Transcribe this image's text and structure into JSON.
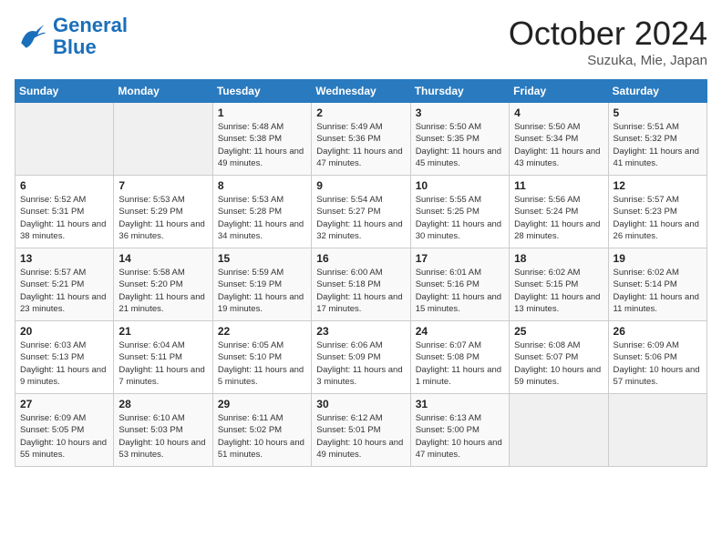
{
  "logo": {
    "text_general": "General",
    "text_blue": "Blue"
  },
  "header": {
    "month": "October 2024",
    "location": "Suzuka, Mie, Japan"
  },
  "days_of_week": [
    "Sunday",
    "Monday",
    "Tuesday",
    "Wednesday",
    "Thursday",
    "Friday",
    "Saturday"
  ],
  "weeks": [
    [
      {
        "day": "",
        "empty": true
      },
      {
        "day": "",
        "empty": true
      },
      {
        "day": "1",
        "sunrise": "5:48 AM",
        "sunset": "5:38 PM",
        "daylight": "11 hours and 49 minutes."
      },
      {
        "day": "2",
        "sunrise": "5:49 AM",
        "sunset": "5:36 PM",
        "daylight": "11 hours and 47 minutes."
      },
      {
        "day": "3",
        "sunrise": "5:50 AM",
        "sunset": "5:35 PM",
        "daylight": "11 hours and 45 minutes."
      },
      {
        "day": "4",
        "sunrise": "5:50 AM",
        "sunset": "5:34 PM",
        "daylight": "11 hours and 43 minutes."
      },
      {
        "day": "5",
        "sunrise": "5:51 AM",
        "sunset": "5:32 PM",
        "daylight": "11 hours and 41 minutes."
      }
    ],
    [
      {
        "day": "6",
        "sunrise": "5:52 AM",
        "sunset": "5:31 PM",
        "daylight": "11 hours and 38 minutes."
      },
      {
        "day": "7",
        "sunrise": "5:53 AM",
        "sunset": "5:29 PM",
        "daylight": "11 hours and 36 minutes."
      },
      {
        "day": "8",
        "sunrise": "5:53 AM",
        "sunset": "5:28 PM",
        "daylight": "11 hours and 34 minutes."
      },
      {
        "day": "9",
        "sunrise": "5:54 AM",
        "sunset": "5:27 PM",
        "daylight": "11 hours and 32 minutes."
      },
      {
        "day": "10",
        "sunrise": "5:55 AM",
        "sunset": "5:25 PM",
        "daylight": "11 hours and 30 minutes."
      },
      {
        "day": "11",
        "sunrise": "5:56 AM",
        "sunset": "5:24 PM",
        "daylight": "11 hours and 28 minutes."
      },
      {
        "day": "12",
        "sunrise": "5:57 AM",
        "sunset": "5:23 PM",
        "daylight": "11 hours and 26 minutes."
      }
    ],
    [
      {
        "day": "13",
        "sunrise": "5:57 AM",
        "sunset": "5:21 PM",
        "daylight": "11 hours and 23 minutes."
      },
      {
        "day": "14",
        "sunrise": "5:58 AM",
        "sunset": "5:20 PM",
        "daylight": "11 hours and 21 minutes."
      },
      {
        "day": "15",
        "sunrise": "5:59 AM",
        "sunset": "5:19 PM",
        "daylight": "11 hours and 19 minutes."
      },
      {
        "day": "16",
        "sunrise": "6:00 AM",
        "sunset": "5:18 PM",
        "daylight": "11 hours and 17 minutes."
      },
      {
        "day": "17",
        "sunrise": "6:01 AM",
        "sunset": "5:16 PM",
        "daylight": "11 hours and 15 minutes."
      },
      {
        "day": "18",
        "sunrise": "6:02 AM",
        "sunset": "5:15 PM",
        "daylight": "11 hours and 13 minutes."
      },
      {
        "day": "19",
        "sunrise": "6:02 AM",
        "sunset": "5:14 PM",
        "daylight": "11 hours and 11 minutes."
      }
    ],
    [
      {
        "day": "20",
        "sunrise": "6:03 AM",
        "sunset": "5:13 PM",
        "daylight": "11 hours and 9 minutes."
      },
      {
        "day": "21",
        "sunrise": "6:04 AM",
        "sunset": "5:11 PM",
        "daylight": "11 hours and 7 minutes."
      },
      {
        "day": "22",
        "sunrise": "6:05 AM",
        "sunset": "5:10 PM",
        "daylight": "11 hours and 5 minutes."
      },
      {
        "day": "23",
        "sunrise": "6:06 AM",
        "sunset": "5:09 PM",
        "daylight": "11 hours and 3 minutes."
      },
      {
        "day": "24",
        "sunrise": "6:07 AM",
        "sunset": "5:08 PM",
        "daylight": "11 hours and 1 minute."
      },
      {
        "day": "25",
        "sunrise": "6:08 AM",
        "sunset": "5:07 PM",
        "daylight": "10 hours and 59 minutes."
      },
      {
        "day": "26",
        "sunrise": "6:09 AM",
        "sunset": "5:06 PM",
        "daylight": "10 hours and 57 minutes."
      }
    ],
    [
      {
        "day": "27",
        "sunrise": "6:09 AM",
        "sunset": "5:05 PM",
        "daylight": "10 hours and 55 minutes."
      },
      {
        "day": "28",
        "sunrise": "6:10 AM",
        "sunset": "5:03 PM",
        "daylight": "10 hours and 53 minutes."
      },
      {
        "day": "29",
        "sunrise": "6:11 AM",
        "sunset": "5:02 PM",
        "daylight": "10 hours and 51 minutes."
      },
      {
        "day": "30",
        "sunrise": "6:12 AM",
        "sunset": "5:01 PM",
        "daylight": "10 hours and 49 minutes."
      },
      {
        "day": "31",
        "sunrise": "6:13 AM",
        "sunset": "5:00 PM",
        "daylight": "10 hours and 47 minutes."
      },
      {
        "day": "",
        "empty": true
      },
      {
        "day": "",
        "empty": true
      }
    ]
  ]
}
